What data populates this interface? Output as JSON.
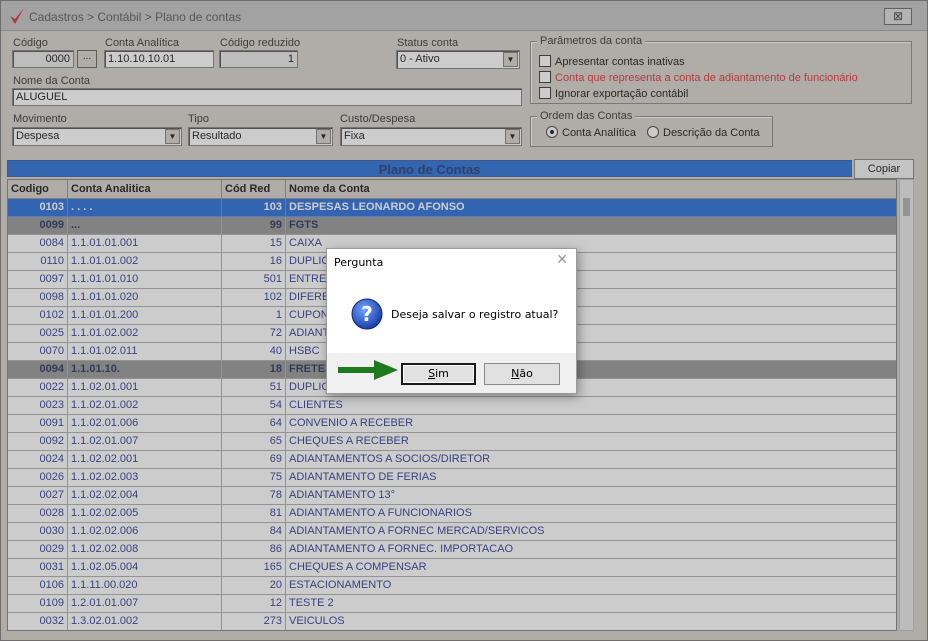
{
  "window": {
    "title": "Cadastros > Contábil > Plano de contas",
    "close_label": "⊠"
  },
  "form": {
    "codigo": {
      "label": "Código",
      "value": "0000",
      "button_label": "..."
    },
    "conta_analitica": {
      "label": "Conta Analítica",
      "value": "1.10.10.10.01"
    },
    "codigo_reduzido": {
      "label": "Código reduzido",
      "value": "1"
    },
    "status": {
      "label": "Status conta",
      "value": "0 - Ativo"
    },
    "nome_conta": {
      "label": "Nome da Conta",
      "value": "ALUGUEL"
    },
    "movimento": {
      "label": "Movimento",
      "value": "Despesa"
    },
    "tipo": {
      "label": "Tipo",
      "value": "Resultado"
    },
    "custo_despesa": {
      "label": "Custo/Despesa",
      "value": "Fixa"
    }
  },
  "parametros": {
    "title": "Parâmetros da conta",
    "options": [
      {
        "label": "Apresentar contas inativas",
        "checked": false
      },
      {
        "label": "Conta que representa a conta de adiantamento de funcionário",
        "checked": false
      },
      {
        "label": "Ignorar exportação contábil",
        "checked": false
      }
    ]
  },
  "ordem": {
    "title": "Ordem das Contas",
    "options": [
      {
        "label": "Conta Analítica",
        "selected": true
      },
      {
        "label": "Descrição da Conta",
        "selected": false
      }
    ]
  },
  "grid": {
    "title": "Plano de Contas",
    "copy_label": "Copiar",
    "columns": [
      "Codigo",
      "Conta Analitica",
      "Cód Red",
      "Nome da Conta"
    ],
    "rows": [
      {
        "codigo": "0103",
        "conta": ". . . .",
        "red": "103",
        "nome": "DESPESAS LEONARDO AFONSO",
        "style": "sel"
      },
      {
        "codigo": "0099",
        "conta": "...",
        "red": "99",
        "nome": "FGTS",
        "style": "bold"
      },
      {
        "codigo": "0084",
        "conta": "1.1.01.01.001",
        "red": "15",
        "nome": "CAIXA",
        "style": ""
      },
      {
        "codigo": "0110",
        "conta": "1.1.01.01.002",
        "red": "16",
        "nome": "DUPLIC",
        "style": ""
      },
      {
        "codigo": "0097",
        "conta": "1.1.01.01.010",
        "red": "501",
        "nome": "ENTRE",
        "style": ""
      },
      {
        "codigo": "0098",
        "conta": "1.1.01.01.020",
        "red": "102",
        "nome": "DIFERE",
        "style": ""
      },
      {
        "codigo": "0102",
        "conta": "1.1.01.01.200",
        "red": "1",
        "nome": "CUPON",
        "style": ""
      },
      {
        "codigo": "0025",
        "conta": "1.1.01.02.002",
        "red": "72",
        "nome": "ADIANT",
        "style": ""
      },
      {
        "codigo": "0070",
        "conta": "1.1.01.02.011",
        "red": "40",
        "nome": "HSBC",
        "style": ""
      },
      {
        "codigo": "0094",
        "conta": "1.1.01.10.",
        "red": "18",
        "nome": "FRETES",
        "style": "bold"
      },
      {
        "codigo": "0022",
        "conta": "1.1.02.01.001",
        "red": "51",
        "nome": "DUPLIC",
        "style": ""
      },
      {
        "codigo": "0023",
        "conta": "1.1.02.01.002",
        "red": "54",
        "nome": "CLIENTES",
        "style": ""
      },
      {
        "codigo": "0091",
        "conta": "1.1.02.01.006",
        "red": "64",
        "nome": "CONVENIO A RECEBER",
        "style": ""
      },
      {
        "codigo": "0092",
        "conta": "1.1.02.01.007",
        "red": "65",
        "nome": "CHEQUES A RECEBER",
        "style": ""
      },
      {
        "codigo": "0024",
        "conta": "1.1.02.02.001",
        "red": "69",
        "nome": "ADIANTAMENTOS A SOCIOS/DIRETOR",
        "style": ""
      },
      {
        "codigo": "0026",
        "conta": "1.1.02.02.003",
        "red": "75",
        "nome": "ADIANTAMENTO DE FERIAS",
        "style": ""
      },
      {
        "codigo": "0027",
        "conta": "1.1.02.02.004",
        "red": "78",
        "nome": "ADIANTAMENTO 13°",
        "style": ""
      },
      {
        "codigo": "0028",
        "conta": "1.1.02.02.005",
        "red": "81",
        "nome": "ADIANTAMENTO A FUNCIONARIOS",
        "style": ""
      },
      {
        "codigo": "0030",
        "conta": "1.1.02.02.006",
        "red": "84",
        "nome": "ADIANTAMENTO A FORNEC MERCAD/SERVICOS",
        "style": ""
      },
      {
        "codigo": "0029",
        "conta": "1.1.02.02.008",
        "red": "86",
        "nome": "ADIANTAMENTO A FORNEC. IMPORTACAO",
        "style": ""
      },
      {
        "codigo": "0031",
        "conta": "1.1.02.05.004",
        "red": "165",
        "nome": "CHEQUES A COMPENSAR",
        "style": ""
      },
      {
        "codigo": "0106",
        "conta": "1.1.11.00.020",
        "red": "20",
        "nome": "ESTACIONAMENTO",
        "style": ""
      },
      {
        "codigo": "0109",
        "conta": "1.2.01.01.007",
        "red": "12",
        "nome": "TESTE 2",
        "style": ""
      },
      {
        "codigo": "0032",
        "conta": "1.3.02.01.002",
        "red": "273",
        "nome": "VEICULOS",
        "style": ""
      }
    ]
  },
  "dialog": {
    "title": "Pergunta",
    "close_label": "✕",
    "message": "Deseja salvar o registro atual?",
    "yes_accel": "S",
    "yes_rest": "im",
    "no_accel": "N",
    "no_rest": "ão",
    "icon": "question-icon"
  },
  "colors": {
    "selected_row": "#1360d6",
    "arrow": "#1f7a1f",
    "red_text": "#e02020"
  }
}
